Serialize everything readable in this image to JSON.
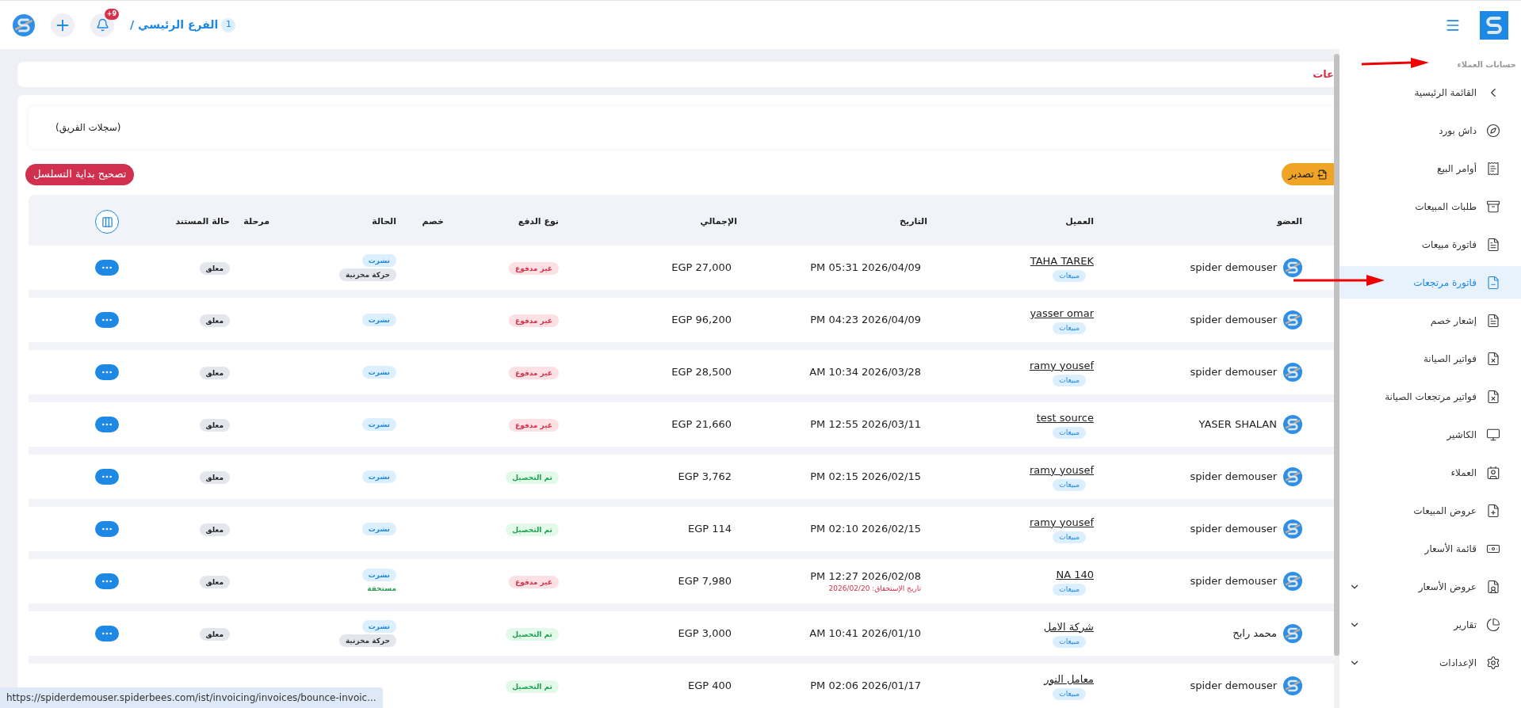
{
  "topbar": {
    "notification_count": "+9",
    "branch_number": "1",
    "breadcrumb": "الفرع الرئيسي /"
  },
  "page_title_fragment": "عات",
  "filter": {
    "text": "(سجلات الفريق)"
  },
  "buttons": {
    "fix_sequence": "تصحيح بداية التسلسل",
    "export": "تصدير"
  },
  "table": {
    "columns": [
      "العضو",
      "العميل",
      "التاريخ",
      "الإجمالي",
      "نوع الدفع",
      "خصم",
      "الحالة",
      "مرحلة",
      "حالة المستند"
    ],
    "rows": [
      {
        "member": "spider demouser",
        "client": "TAHA TAREK",
        "tag": "مبيعات",
        "date": "PM 05:31 2026/04/09",
        "total": "EGP 27,000",
        "payment": {
          "text": "غير مدفوع",
          "kind": "unpaid"
        },
        "status": [
          {
            "text": "نشرت",
            "kind": "info"
          },
          {
            "text": "حركة مخزنية",
            "kind": "neutral"
          }
        ],
        "doc_status": "معلق"
      },
      {
        "member": "spider demouser",
        "client": "yasser omar",
        "tag": "مبيعات",
        "date": "PM 04:23 2026/04/09",
        "total": "EGP 96,200",
        "payment": {
          "text": "غير مدفوع",
          "kind": "unpaid"
        },
        "status": [
          {
            "text": "نشرت",
            "kind": "info"
          }
        ],
        "doc_status": "معلق"
      },
      {
        "member": "spider demouser",
        "client": "ramy yousef",
        "tag": "مبيعات",
        "date": "AM 10:34 2026/03/28",
        "total": "EGP 28,500",
        "payment": {
          "text": "غير مدفوع",
          "kind": "unpaid"
        },
        "status": [
          {
            "text": "نشرت",
            "kind": "info"
          }
        ],
        "doc_status": "معلق"
      },
      {
        "member": "YASER SHALAN",
        "client": "test source",
        "tag": "مبيعات",
        "date": "PM 12:55 2026/03/11",
        "total": "EGP 21,660",
        "payment": {
          "text": "غير مدفوع",
          "kind": "unpaid"
        },
        "status": [
          {
            "text": "نشرت",
            "kind": "info"
          }
        ],
        "doc_status": "معلق"
      },
      {
        "member": "spider demouser",
        "client": "ramy yousef",
        "tag": "مبيعات",
        "date": "PM 02:15 2026/02/15",
        "total": "EGP 3,762",
        "payment": {
          "text": "تم التحصيل",
          "kind": "collected"
        },
        "status": [
          {
            "text": "نشرت",
            "kind": "info"
          }
        ],
        "doc_status": "معلق"
      },
      {
        "member": "spider demouser",
        "client": "ramy yousef",
        "tag": "مبيعات",
        "date": "PM 02:10 2026/02/15",
        "total": "EGP 114",
        "payment": {
          "text": "تم التحصيل",
          "kind": "collected"
        },
        "status": [
          {
            "text": "نشرت",
            "kind": "info"
          }
        ],
        "doc_status": "معلق"
      },
      {
        "member": "spider demouser",
        "client": "NA 140",
        "tag": "مبيعات",
        "date": "PM 12:27 2026/02/08",
        "due": "تاريخ الإستحقاق: 2026/02/20",
        "total": "EGP 7,980",
        "payment": {
          "text": "غير مدفوع",
          "kind": "unpaid"
        },
        "status": [
          {
            "text": "نشرت",
            "kind": "info"
          },
          {
            "text": "مستحقة",
            "kind": "success"
          }
        ],
        "doc_status": "معلق"
      },
      {
        "member": "محمد رابح",
        "client": "شركة الامل",
        "tag": "مبيعات",
        "date": "AM 10:41 2026/01/10",
        "total": "EGP 3,000",
        "payment": {
          "text": "تم التحصيل",
          "kind": "collected"
        },
        "status": [
          {
            "text": "نشرت",
            "kind": "info"
          },
          {
            "text": "حركة مخزنية",
            "kind": "neutral"
          }
        ],
        "doc_status": "معلق"
      },
      {
        "member": "spider demouser",
        "client": "معامل النور",
        "tag": "مبيعات",
        "date": "PM 02:06 2026/01/17",
        "total": "EGP 400",
        "payment": {
          "text": "تم التحصيل",
          "kind": "collected"
        }
      }
    ]
  },
  "sidebar": {
    "heading": "حسابات العملاء",
    "items": [
      {
        "label": "القائمة الرئيسية",
        "kind": "back",
        "selected": false
      },
      {
        "label": "داش بورد",
        "kind": "link",
        "selected": false
      },
      {
        "label": "أوامر البيع",
        "kind": "link",
        "selected": false
      },
      {
        "label": "طلبات المبيعات",
        "kind": "link",
        "selected": false
      },
      {
        "label": "فاتورة مبيعات",
        "kind": "link",
        "selected": false
      },
      {
        "label": "فاتورة مرتجعات",
        "kind": "link",
        "selected": true
      },
      {
        "label": "إشعار خصم",
        "kind": "link",
        "selected": false
      },
      {
        "label": "فواتير الصيانة",
        "kind": "link",
        "selected": false
      },
      {
        "label": "فواتير مرتجعات الصيانة",
        "kind": "link",
        "selected": false
      },
      {
        "label": "الكاشير",
        "kind": "link",
        "selected": false
      },
      {
        "label": "العملاء",
        "kind": "link",
        "selected": false
      },
      {
        "label": "عروض المبيعات",
        "kind": "link",
        "selected": false
      },
      {
        "label": "قائمة الأسعار",
        "kind": "link",
        "selected": false
      },
      {
        "label": "عروض الأسعار",
        "kind": "group",
        "selected": false
      },
      {
        "label": "تقارير",
        "kind": "group",
        "selected": false
      },
      {
        "label": "الإعدادات",
        "kind": "group",
        "selected": false
      }
    ]
  },
  "status_url": "https://spiderdemouser.spiderbees.com/ist/invoicing/invoices/bounce-invoic..."
}
